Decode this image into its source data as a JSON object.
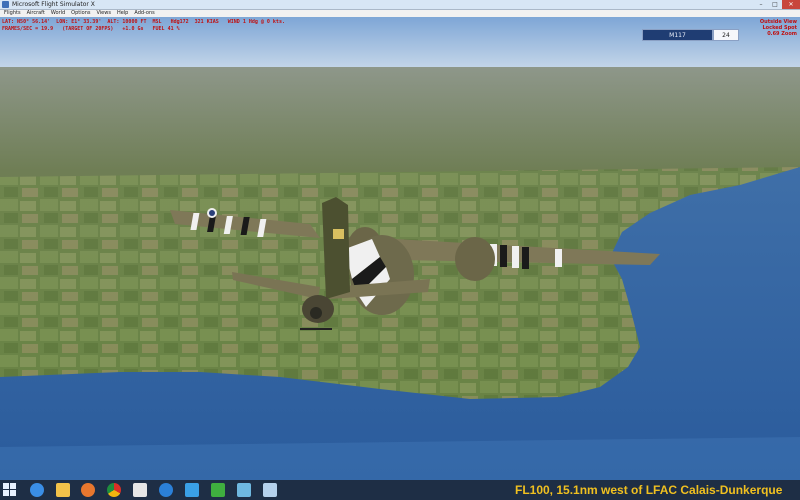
{
  "window": {
    "title": "Microsoft Flight Simulator X"
  },
  "menu": [
    "Flights",
    "Aircraft",
    "World",
    "Options",
    "Views",
    "Help",
    "Add-ons"
  ],
  "info": {
    "line1": "LAT: N50° 56.14'  LON: E1° 33.39'  ALT: 10000 FT  MSL   Hdg172  321 KIAS   WIND 1 Hdg @ 0 kts.",
    "line2": "FRAMES/SEC = 19.9   (TARGET OF 20FPS)   +1.0 Gs   FUEL 41 %"
  },
  "view": {
    "line1": "Outside View",
    "line2": "Locked Spot",
    "line3": "0.69 Zoom"
  },
  "multiplayer": {
    "callsign": "M117",
    "count": "24"
  },
  "status": "FL100, 15.1nm west of LFAC Calais-Dunkerque",
  "taskbar_icons": [
    "start-icon",
    "ie-icon",
    "explorer-icon",
    "media-player-icon",
    "chrome-icon",
    "image-icon",
    "edge-icon",
    "flight-icon",
    "green-app-icon",
    "photo-icon",
    "window-icon"
  ],
  "colors": {
    "info_text": "#c01010",
    "status_text": "#f0c020",
    "taskbar": "#1e2e45"
  }
}
